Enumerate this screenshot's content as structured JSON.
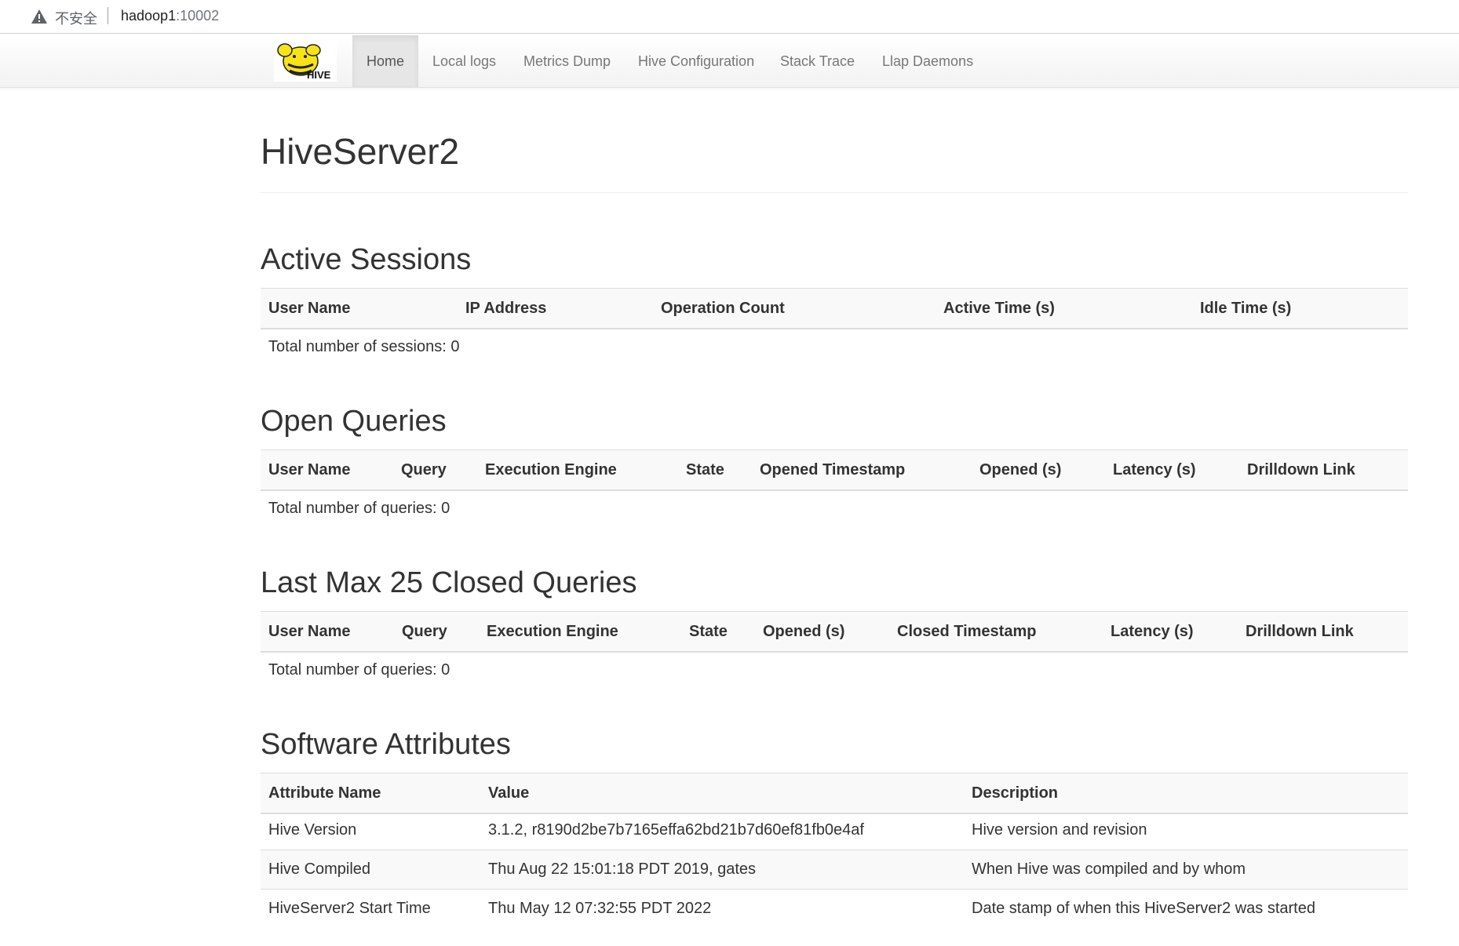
{
  "browser": {
    "security_label": "不安全",
    "url_host": "hadoop1",
    "url_port": ":10002"
  },
  "nav": {
    "items": [
      {
        "label": "Home",
        "active": true
      },
      {
        "label": "Local logs"
      },
      {
        "label": "Metrics Dump"
      },
      {
        "label": "Hive Configuration"
      },
      {
        "label": "Stack Trace"
      },
      {
        "label": "Llap Daemons"
      }
    ],
    "logo_text": "HIVE"
  },
  "page": {
    "title": "HiveServer2"
  },
  "active_sessions": {
    "title": "Active Sessions",
    "columns": [
      "User Name",
      "IP Address",
      "Operation Count",
      "Active Time (s)",
      "Idle Time (s)"
    ],
    "total": "Total number of sessions: 0"
  },
  "open_queries": {
    "title": "Open Queries",
    "columns": [
      "User Name",
      "Query",
      "Execution Engine",
      "State",
      "Opened Timestamp",
      "Opened (s)",
      "Latency (s)",
      "Drilldown Link"
    ],
    "total": "Total number of queries: 0"
  },
  "closed_queries": {
    "title": "Last Max 25 Closed Queries",
    "columns": [
      "User Name",
      "Query",
      "Execution Engine",
      "State",
      "Opened (s)",
      "Closed Timestamp",
      "Latency (s)",
      "Drilldown Link"
    ],
    "total": "Total number of queries: 0"
  },
  "software_attributes": {
    "title": "Software Attributes",
    "columns": [
      "Attribute Name",
      "Value",
      "Description"
    ],
    "rows": [
      [
        "Hive Version",
        "3.1.2, r8190d2be7b7165effa62bd21b7d60ef81fb0e4af",
        "Hive version and revision"
      ],
      [
        "Hive Compiled",
        "Thu Aug 22 15:01:18 PDT 2019, gates",
        "When Hive was compiled and by whom"
      ],
      [
        "HiveServer2 Start Time",
        "Thu May 12 07:32:55 PDT 2022",
        "Date stamp of when this HiveServer2 was started"
      ]
    ]
  }
}
